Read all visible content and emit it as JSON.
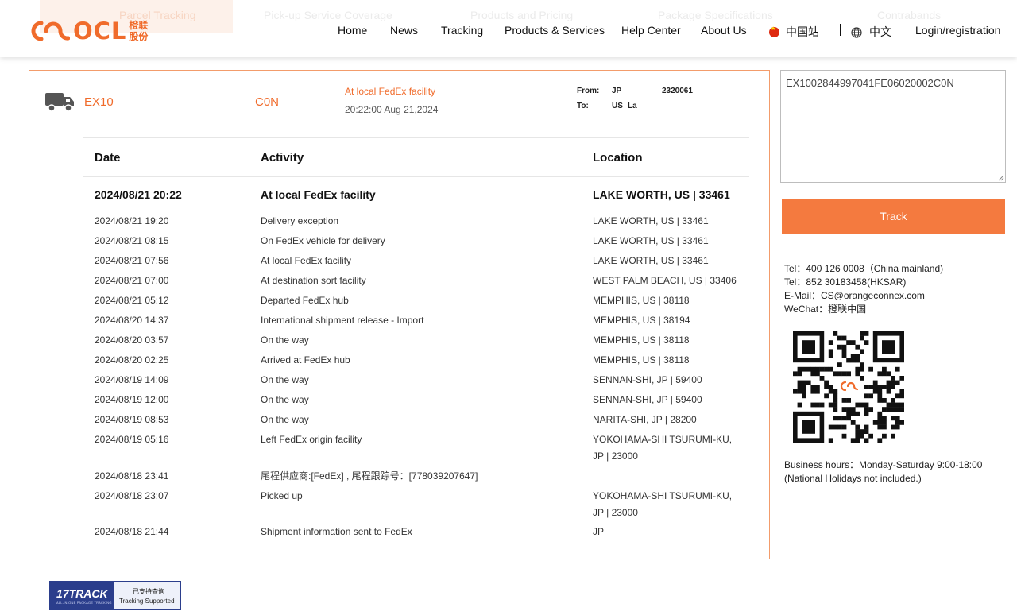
{
  "header": {
    "ghost_tabs": [
      "Parcel Tracking",
      "Pick-up Service Coverage",
      "Products and Pricing",
      "Package Specifications",
      "Contrabands"
    ],
    "logo": {
      "text": "OCL",
      "cn_top": "橙联",
      "cn_bottom": "股份"
    },
    "nav": [
      {
        "label": "Home"
      },
      {
        "label": "News"
      },
      {
        "label": "Tracking"
      },
      {
        "label": "Products & Services"
      },
      {
        "label": "Help Center"
      },
      {
        "label": "About Us"
      }
    ],
    "region_label": "中国站",
    "language_label": "中文",
    "login_label": "Login/registration"
  },
  "shipment": {
    "code_a": "EX10",
    "code_b": "C0N",
    "status": "At local FedEx facility",
    "status_time": "20:22:00 Aug 21,2024",
    "from_label": "From:",
    "from_country": "JP",
    "from_postal": "2320061",
    "to_label": "To:",
    "to_country": "US",
    "to_city": "La"
  },
  "table": {
    "headers": {
      "date": "Date",
      "activity": "Activity",
      "location": "Location"
    },
    "rows": [
      {
        "date": "2024/08/21 20:22",
        "activity": "At local FedEx facility",
        "location": "LAKE WORTH, US | 33461"
      },
      {
        "date": "2024/08/21 19:20",
        "activity": "Delivery exception",
        "location": "LAKE WORTH, US | 33461"
      },
      {
        "date": "2024/08/21 08:15",
        "activity": "On FedEx vehicle for delivery",
        "location": "LAKE WORTH, US | 33461"
      },
      {
        "date": "2024/08/21 07:56",
        "activity": "At local FedEx facility",
        "location": "LAKE WORTH, US | 33461"
      },
      {
        "date": "2024/08/21 07:00",
        "activity": "At destination sort facility",
        "location": "WEST PALM BEACH, US | 33406"
      },
      {
        "date": "2024/08/21 05:12",
        "activity": "Departed FedEx hub",
        "location": "MEMPHIS, US | 38118"
      },
      {
        "date": "2024/08/20 14:37",
        "activity": "International shipment release - Import",
        "location": "MEMPHIS, US | 38194"
      },
      {
        "date": "2024/08/20 03:57",
        "activity": "On the way",
        "location": "MEMPHIS, US | 38118"
      },
      {
        "date": "2024/08/20 02:25",
        "activity": "Arrived at FedEx hub",
        "location": "MEMPHIS, US | 38118"
      },
      {
        "date": "2024/08/19 14:09",
        "activity": "On the way",
        "location": "SENNAN-SHI, JP | 59400"
      },
      {
        "date": "2024/08/19 12:00",
        "activity": "On the way",
        "location": "SENNAN-SHI, JP | 59400"
      },
      {
        "date": "2024/08/19 08:53",
        "activity": "On the way",
        "location": "NARITA-SHI, JP | 28200"
      },
      {
        "date": "2024/08/19 05:16",
        "activity": "Left FedEx origin facility",
        "location": "YOKOHAMA-SHI TSURUMI-KU, JP | 23000"
      },
      {
        "date": "2024/08/18 23:41",
        "activity": "尾程供应商:[FedEx] , 尾程跟踪号：[778039207647]",
        "location": ""
      },
      {
        "date": "2024/08/18 23:07",
        "activity": "Picked up",
        "location": "YOKOHAMA-SHI TSURUMI-KU, JP | 23000"
      },
      {
        "date": "2024/08/18 21:44",
        "activity": "Shipment information sent to FedEx",
        "location": "JP"
      }
    ]
  },
  "sidebar": {
    "tracking_value": "EX1002844997041FE06020002C0N",
    "track_button": "Track",
    "contact": [
      "Tel：400 126 0008（China mainland)",
      "Tel：852 30183458(HKSAR)",
      "E-Mail：CS@orangeconnex.com",
      "WeChat：橙联中国"
    ],
    "hours": [
      "Business hours：Monday-Saturday 9:00-18:00",
      "(National Holidays not included.)"
    ]
  },
  "footer": {
    "badge_title": "17TRACK",
    "badge_sub": "ALL-IN-ONE PACKAGE TRACKING",
    "badge_cn": "已支持查询",
    "badge_en": "Tracking Supported"
  },
  "colors": {
    "accent": "#f06b2b",
    "button": "#f47a3f",
    "panel_border": "#f39c6b",
    "badge": "#2b3e8c"
  }
}
